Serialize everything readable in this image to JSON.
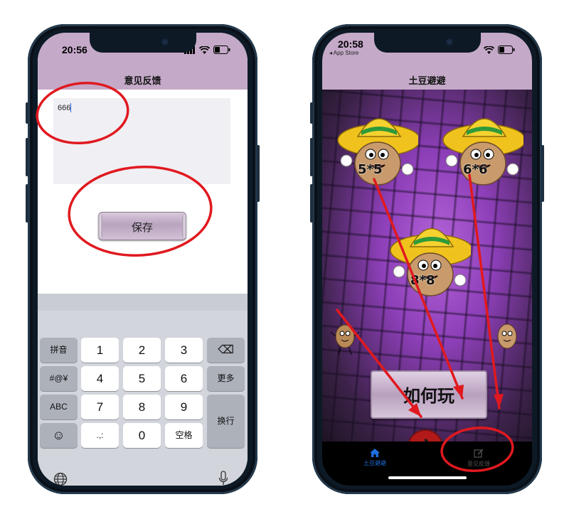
{
  "left_phone": {
    "status": {
      "time": "20:56"
    },
    "nav": {
      "title": "意见反馈"
    },
    "feedback_input": {
      "value": "666"
    },
    "save_button": {
      "label": "保存"
    },
    "keyboard": {
      "row1": [
        "拼音",
        "1",
        "2",
        "3",
        "⌫"
      ],
      "row2": [
        "#@¥",
        "4",
        "5",
        "6",
        "更多"
      ],
      "row3": [
        "ABC",
        "7",
        "8",
        "9"
      ],
      "row4": [
        "☺",
        ".,:",
        "0",
        "空格"
      ],
      "return_label": "换行"
    }
  },
  "right_phone": {
    "status": {
      "time": "20:58",
      "back_app": "◂ App Store"
    },
    "nav": {
      "title": "土豆避避"
    },
    "levels": [
      {
        "label": "5*5"
      },
      {
        "label": "6*6"
      },
      {
        "label": "8*8"
      }
    ],
    "how_to_play_button": {
      "label": "如何玩"
    },
    "tabs": [
      {
        "label": "土豆避避",
        "icon": "home-icon",
        "active": true
      },
      {
        "label": "意见反馈",
        "icon": "edit-icon",
        "active": false
      }
    ]
  },
  "colors": {
    "nav_bar": "#c4a9c8",
    "annotation_red": "#e0191f",
    "tab_active": "#1e6fe0"
  }
}
